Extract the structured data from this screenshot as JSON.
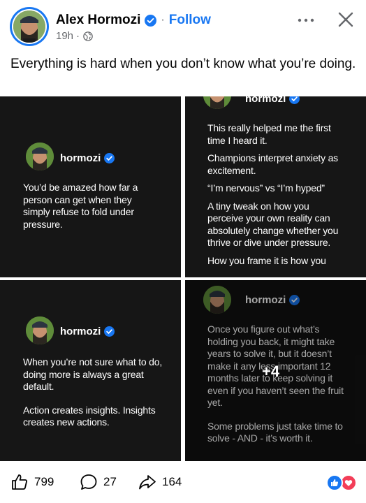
{
  "post": {
    "author": "Alex Hormozi",
    "follow_label": "Follow",
    "separator": "·",
    "time": "19h",
    "time_dot": "·",
    "caption": "Everything is hard when you don’t know what you’re doing."
  },
  "images": [
    {
      "handle": "hormozi",
      "paragraphs": [
        "You’d be amazed how far a person can get when they simply refuse to fold under pressure."
      ]
    },
    {
      "handle": "hormozi",
      "paragraphs": [
        "This really helped me the first time I heard it.",
        "Champions interpret anxiety as excitement.",
        "“I’m nervous” vs “I’m hyped”",
        "A tiny tweak on how you perceive your own reality can absolutely change whether you thrive or dive under pressure.",
        "How you frame it is how you"
      ]
    },
    {
      "handle": "hormozi",
      "paragraphs": [
        "When you’re not sure what to do, doing more is always a great default.",
        "Action creates insights. Insights creates new actions."
      ]
    },
    {
      "handle": "hormozi",
      "paragraphs": [
        "Once you figure out what’s holding you back, it might take years to solve it, but it doesn’t make it any less important 12 months later to keep solving it even if you haven’t seen the fruit yet.",
        "Some problems just take time to solve - AND - it’s worth it."
      ],
      "more_count": "+4"
    }
  ],
  "actions": {
    "likes": "799",
    "comments": "27",
    "shares": "164"
  },
  "icons": {
    "verified": "verified-badge-icon",
    "globe": "globe-icon",
    "more": "more-options-icon",
    "close": "close-icon",
    "like": "thumbs-up-icon",
    "comment": "comment-icon",
    "share": "share-icon",
    "reactions": "like-love-reactions-icon"
  },
  "colors": {
    "accent": "#1877f2",
    "love": "#f33e58",
    "tile_bg": "#161616"
  }
}
